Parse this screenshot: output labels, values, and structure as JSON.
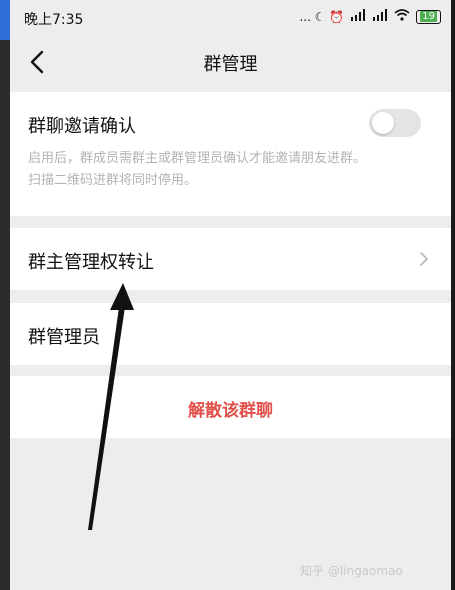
{
  "status_bar": {
    "time": "晚上7:35",
    "indicators": "... ☾ ⏰",
    "signal_1": "HD",
    "signal_2": "HD",
    "battery": "19"
  },
  "nav": {
    "title": "群管理",
    "back_icon": "chevron-left-icon"
  },
  "settings": {
    "invite_confirm": {
      "label": "群聊邀请确认",
      "enabled": false,
      "desc_line1": "启用后，群成员需群主或群管理员确认才能邀请朋友进群。",
      "desc_line2": "扫描二维码进群将同时停用。"
    },
    "transfer_owner": {
      "label": "群主管理权转让",
      "chevron_icon": "chevron-right-icon"
    },
    "admins": {
      "label": "群管理员"
    },
    "dissolve": {
      "label": "解散该群聊",
      "color": "#e1504b"
    }
  },
  "watermark": "知乎 @lingaomao"
}
